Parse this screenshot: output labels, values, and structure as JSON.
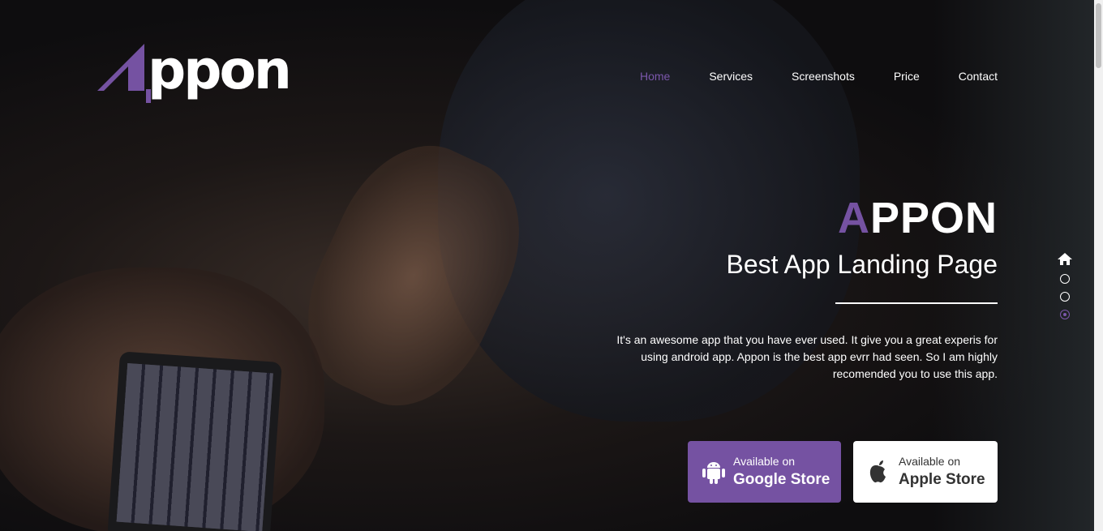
{
  "logo": {
    "text": "ppon",
    "letter": "A"
  },
  "nav": [
    {
      "label": "Home",
      "active": true
    },
    {
      "label": "Services"
    },
    {
      "label": "Screenshots"
    },
    {
      "label": "Price"
    },
    {
      "label": "Contact"
    }
  ],
  "hero": {
    "title_first": "A",
    "title_rest": "PPON",
    "subtitle": "Best App Landing Page",
    "description": "It's an awesome app that you have ever used. It give you a great experis for using android app. Appon is the best app evrr had seen. So I am highly recomended you to use this app."
  },
  "buttons": {
    "google": {
      "line1": "Available on",
      "line2": "Google Store",
      "icon": "android-icon"
    },
    "apple": {
      "line1": "Available on",
      "line2": "Apple Store",
      "icon": "apple-icon"
    }
  },
  "colors": {
    "accent": "#7552a2"
  }
}
